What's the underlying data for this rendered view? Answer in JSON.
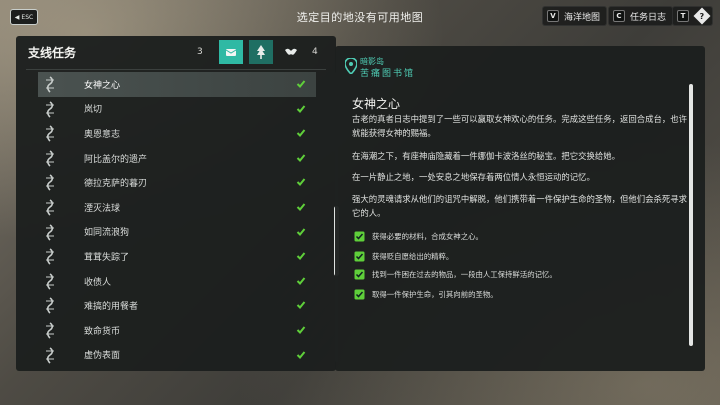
{
  "topbar": {
    "esc_label": "ESC",
    "title": "选定目的地没有可用地图",
    "nav": [
      {
        "key": "V",
        "label": "海洋地图"
      },
      {
        "key": "C",
        "label": "任务日志"
      },
      {
        "key": "T",
        "label": "?"
      }
    ]
  },
  "side_quests": {
    "title": "支线任务",
    "count_left": "3",
    "count_right": "4",
    "filters": [
      "scroll-icon",
      "tree-icon",
      "bird-icon"
    ],
    "items": [
      {
        "label": "女神之心",
        "completed": true,
        "selected": true
      },
      {
        "label": "岚切",
        "completed": true
      },
      {
        "label": "奥恩意志",
        "completed": true
      },
      {
        "label": "阿比盖尔的遗产",
        "completed": true
      },
      {
        "label": "德拉克萨的暮刃",
        "completed": true
      },
      {
        "label": "湮灭法球",
        "completed": true
      },
      {
        "label": "如同流浪狗",
        "completed": true
      },
      {
        "label": "茸茸失踪了",
        "completed": true
      },
      {
        "label": "收债人",
        "completed": true
      },
      {
        "label": "难搞的用餐者",
        "completed": true
      },
      {
        "label": "致命货币",
        "completed": true
      },
      {
        "label": "虚伪表面",
        "completed": true
      }
    ]
  },
  "detail": {
    "region": "暗影岛",
    "location": "苦痛图书馆",
    "title": "女神之心",
    "paragraphs": [
      "古老的真者日志中提到了一些可以赢取女神欢心的任务。完成这些任务，返回合成台，也许就能获得女神的赐福。",
      "在海潮之下，有座神庙隐藏着一件娜伽卡波洛丝的秘宝。把它交换给她。",
      "在一片静止之地，一处安息之地保存着两位情人永恒运动的记忆。",
      "强大的灵魂请求从他们的诅咒中解脱，他们携带着一件保护生命的圣物，但他们会杀死寻求它的人。"
    ],
    "objectives": [
      "获得必要的材料，合成女神之心。",
      "获得贬自愿给出的精粹。",
      "找到一件困在过去的物品，一段由人工保持鲜活的记忆。",
      "取得一件保护生命，引其向前的圣物。"
    ]
  },
  "colors": {
    "accent": "#2fb9a4",
    "check_green": "#5fcf3a",
    "panel_bg": "#1c1f1e"
  }
}
